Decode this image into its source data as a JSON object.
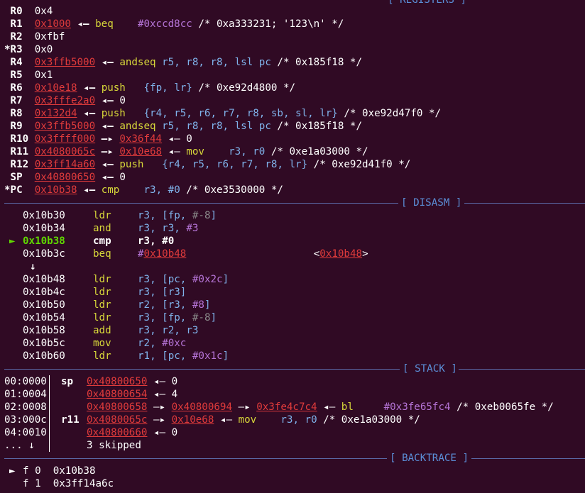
{
  "headers": {
    "registers": "[ REGISTERS ]",
    "disasm": "[ DISASM ]",
    "stack": "[ STACK ]",
    "backtrace": "[ BACKTRACE ]"
  },
  "registers": [
    {
      "name": " R0",
      "value": "0x4",
      "arrow": "",
      "tail": []
    },
    {
      "name": " R1",
      "value": "0x1000",
      "arrow": "◂—",
      "tail": [
        {
          "t": "beq",
          "c": "m"
        },
        {
          "t": "    "
        },
        {
          "t": "#0xccd8cc",
          "c": "imm"
        },
        {
          "t": " /* 0xa333231; '123\\n' */"
        }
      ]
    },
    {
      "name": " R2",
      "value": "0xfbf",
      "arrow": "",
      "tail": []
    },
    {
      "name": "*R3",
      "value": "0x0",
      "arrow": "",
      "tail": []
    },
    {
      "name": " R4",
      "value": "0x3ffb5000",
      "arrow": "◂—",
      "tail": [
        {
          "t": "andseq",
          "c": "m"
        },
        {
          "t": " "
        },
        {
          "t": "r5, r8, r8, lsl pc",
          "c": "ops"
        },
        {
          "t": " /* 0x185f18 */"
        }
      ]
    },
    {
      "name": " R5",
      "value": "0x1",
      "arrow": "",
      "tail": []
    },
    {
      "name": " R6",
      "value": "0x10e18",
      "arrow": "◂—",
      "tail": [
        {
          "t": "push",
          "c": "m"
        },
        {
          "t": "   "
        },
        {
          "t": "{fp, lr}",
          "c": "ops"
        },
        {
          "t": " /* 0xe92d4800 */"
        }
      ]
    },
    {
      "name": " R7",
      "value": "0x3fffe2a0",
      "arrow": "◂—",
      "tail": [
        {
          "t": "0"
        }
      ]
    },
    {
      "name": " R8",
      "value": "0x132d4",
      "arrow": "◂—",
      "tail": [
        {
          "t": "push",
          "c": "m"
        },
        {
          "t": "   "
        },
        {
          "t": "{r4, r5, r6, r7, r8, sb, sl, lr}",
          "c": "ops"
        },
        {
          "t": " /* 0xe92d47f0 */"
        }
      ]
    },
    {
      "name": " R9",
      "value": "0x3ffb5000",
      "arrow": "◂—",
      "tail": [
        {
          "t": "andseq",
          "c": "m"
        },
        {
          "t": " "
        },
        {
          "t": "r5, r8, r8, lsl pc",
          "c": "ops"
        },
        {
          "t": " /* 0x185f18 */"
        }
      ]
    },
    {
      "name": " R10",
      "value": "0x3ffff000",
      "arrow": "—▸",
      "tail": [
        {
          "t": "0x36f44",
          "c": "addr"
        },
        {
          "t": " ◂— 0"
        }
      ]
    },
    {
      "name": " R11",
      "value": "0x4080065c",
      "arrow": "—▸",
      "tail": [
        {
          "t": "0x10e68",
          "c": "addr"
        },
        {
          "t": " ◂— "
        },
        {
          "t": "mov",
          "c": "m"
        },
        {
          "t": "    "
        },
        {
          "t": "r3, r0",
          "c": "ops"
        },
        {
          "t": " /* 0xe1a03000 */"
        }
      ]
    },
    {
      "name": " R12",
      "value": "0x3ff14a60",
      "arrow": "◂—",
      "tail": [
        {
          "t": "push",
          "c": "m"
        },
        {
          "t": "   "
        },
        {
          "t": "{r4, r5, r6, r7, r8, lr}",
          "c": "ops"
        },
        {
          "t": " /* 0xe92d41f0 */"
        }
      ]
    },
    {
      "name": " SP",
      "value": "0x40800650",
      "arrow": "◂—",
      "tail": [
        {
          "t": "0"
        }
      ]
    },
    {
      "name": "*PC",
      "value": "0x10b38",
      "arrow": "◂—",
      "tail": [
        {
          "t": "cmp",
          "c": "m"
        },
        {
          "t": "    "
        },
        {
          "t": "r3, #0",
          "c": "ops"
        },
        {
          "t": " /* 0xe3530000 */"
        }
      ]
    }
  ],
  "disasm": [
    {
      "addr": "0x10b30",
      "mn": "ldr",
      "ops": [
        {
          "t": "r3, [fp, ",
          "c": "ops"
        },
        {
          "t": "#-8",
          "c": "gray"
        },
        {
          "t": "]",
          "c": "ops"
        }
      ]
    },
    {
      "addr": "0x10b34",
      "mn": "and",
      "ops": [
        {
          "t": "r3, r3, ",
          "c": "ops"
        },
        {
          "t": "#3",
          "c": "imm"
        }
      ]
    },
    {
      "addr": "0x10b38",
      "mn": "cmp",
      "ops": [
        {
          "t": "r3, ",
          "c": "wb"
        },
        {
          "t": "#0",
          "c": "wb"
        }
      ],
      "current": true
    },
    {
      "addr": "0x10b3c",
      "mn": "beq",
      "ops": [
        {
          "t": "#",
          "c": "imm"
        },
        {
          "t": "0x10b48",
          "c": "addr"
        },
        {
          "t": "                     <"
        },
        {
          "t": "0x10b48",
          "c": "addr"
        },
        {
          "t": ">"
        }
      ]
    },
    {
      "addr": "↓",
      "mn": "",
      "ops": [],
      "gap": true
    },
    {
      "addr": "0x10b48",
      "mn": "ldr",
      "ops": [
        {
          "t": "r3, [pc, ",
          "c": "ops"
        },
        {
          "t": "#0x2c",
          "c": "imm"
        },
        {
          "t": "]",
          "c": "ops"
        }
      ]
    },
    {
      "addr": "0x10b4c",
      "mn": "ldr",
      "ops": [
        {
          "t": "r3, [r3]",
          "c": "ops"
        }
      ]
    },
    {
      "addr": "0x10b50",
      "mn": "ldr",
      "ops": [
        {
          "t": "r2, [r3, ",
          "c": "ops"
        },
        {
          "t": "#8",
          "c": "imm"
        },
        {
          "t": "]",
          "c": "ops"
        }
      ]
    },
    {
      "addr": "0x10b54",
      "mn": "ldr",
      "ops": [
        {
          "t": "r3, [fp, ",
          "c": "ops"
        },
        {
          "t": "#-8",
          "c": "gray"
        },
        {
          "t": "]",
          "c": "ops"
        }
      ]
    },
    {
      "addr": "0x10b58",
      "mn": "add",
      "ops": [
        {
          "t": "r3, r2, r3",
          "c": "ops"
        }
      ]
    },
    {
      "addr": "0x10b5c",
      "mn": "mov",
      "ops": [
        {
          "t": "r2, ",
          "c": "ops"
        },
        {
          "t": "#0xc",
          "c": "imm"
        }
      ]
    },
    {
      "addr": "0x10b60",
      "mn": "ldr",
      "ops": [
        {
          "t": "r1, [pc, ",
          "c": "ops"
        },
        {
          "t": "#0x1c",
          "c": "imm"
        },
        {
          "t": "]",
          "c": "ops"
        }
      ]
    }
  ],
  "stack": [
    {
      "off": "00:0000",
      "reg": "sp",
      "val": "0x40800650",
      "tail": [
        {
          "t": " ◂— 0"
        }
      ]
    },
    {
      "off": "01:0004",
      "reg": "",
      "val": "0x40800654",
      "tail": [
        {
          "t": " ◂— 4"
        }
      ]
    },
    {
      "off": "02:0008",
      "reg": "",
      "val": "0x40800658",
      "tail": [
        {
          "t": " —▸ "
        },
        {
          "t": "0x40800694",
          "c": "addr"
        },
        {
          "t": " —▸ "
        },
        {
          "t": "0x3fe4c7c4",
          "c": "addr"
        },
        {
          "t": " ◂— "
        },
        {
          "t": "bl",
          "c": "m"
        },
        {
          "t": "     "
        },
        {
          "t": "#0x3fe65fc4",
          "c": "imm"
        },
        {
          "t": " /* 0xeb0065fe */"
        }
      ]
    },
    {
      "off": "03:000c",
      "reg": "r11",
      "val": "0x4080065c",
      "tail": [
        {
          "t": " —▸ "
        },
        {
          "t": "0x10e68",
          "c": "addr"
        },
        {
          "t": " ◂— "
        },
        {
          "t": "mov",
          "c": "m"
        },
        {
          "t": "    "
        },
        {
          "t": "r3, r0",
          "c": "ops"
        },
        {
          "t": " /* 0xe1a03000 */"
        }
      ]
    },
    {
      "off": "04:0010",
      "reg": "",
      "val": "0x40800660",
      "tail": [
        {
          "t": " ◂— 0"
        }
      ]
    }
  ],
  "stack_skip": {
    "left": "... ↓",
    "text": "3 skipped"
  },
  "backtrace": [
    {
      "marker": "►",
      "frame": "f 0",
      "addr": "0x10b38"
    },
    {
      "marker": " ",
      "frame": "f 1",
      "addr": "0x3ff14a6c"
    }
  ],
  "colors": {
    "bg": "#300a24",
    "addr": "#e03b3b",
    "mnemonic": "#d7d73a",
    "operand": "#7fb2ea",
    "immediate": "#b574d6",
    "current": "#5fd700"
  }
}
